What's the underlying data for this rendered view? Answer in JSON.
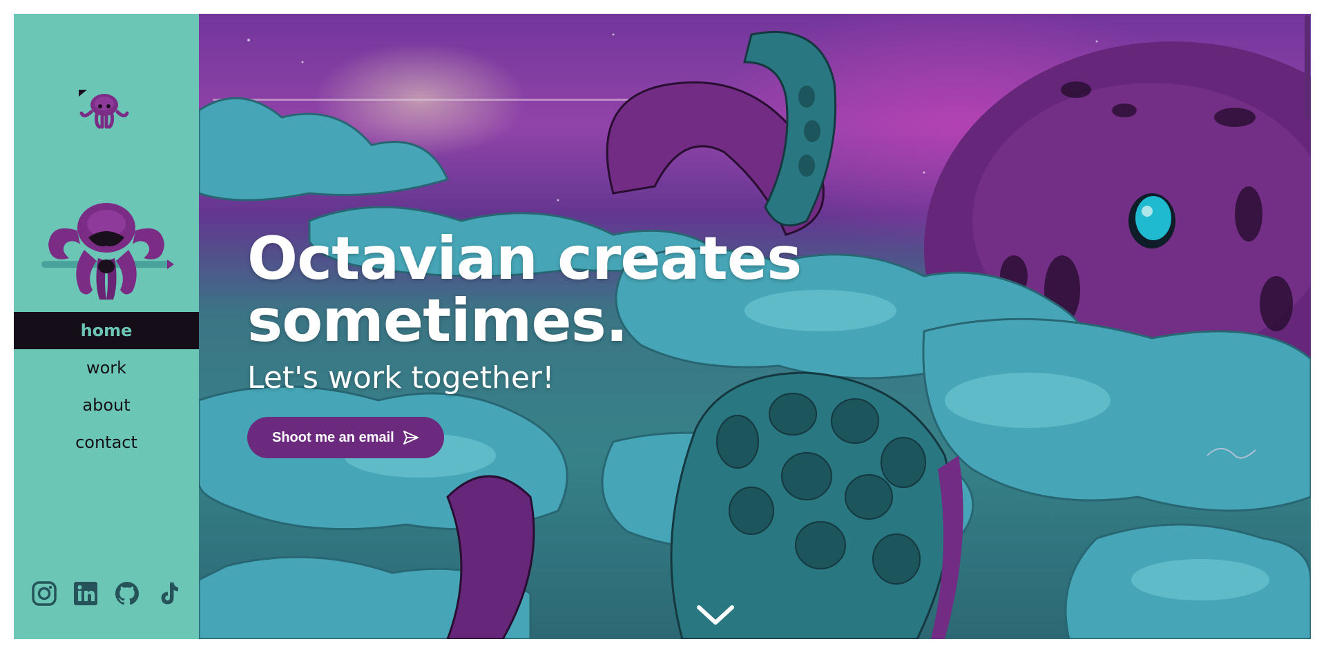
{
  "colors": {
    "sidebar_bg": "#6cc6b5",
    "nav_active_bg": "#150d18",
    "nav_active_text": "#6cc6b5",
    "button_bg": "#6b2a7e",
    "octopus_purple": "#7b2d86"
  },
  "sidebar": {
    "icons": [
      "octopus-logo-small",
      "octopus-logo-large"
    ],
    "nav": [
      {
        "label": "home",
        "active": true
      },
      {
        "label": "work",
        "active": false
      },
      {
        "label": "about",
        "active": false
      },
      {
        "label": "contact",
        "active": false
      }
    ],
    "socials": [
      "instagram-icon",
      "linkedin-icon",
      "github-icon",
      "tiktok-icon"
    ]
  },
  "hero": {
    "headline": "Octavian creates sometimes.",
    "subhead": "Let's work together!",
    "cta_label": "Shoot me an email",
    "cta_icon": "send-icon",
    "scroll_icon": "chevron-down-icon"
  }
}
